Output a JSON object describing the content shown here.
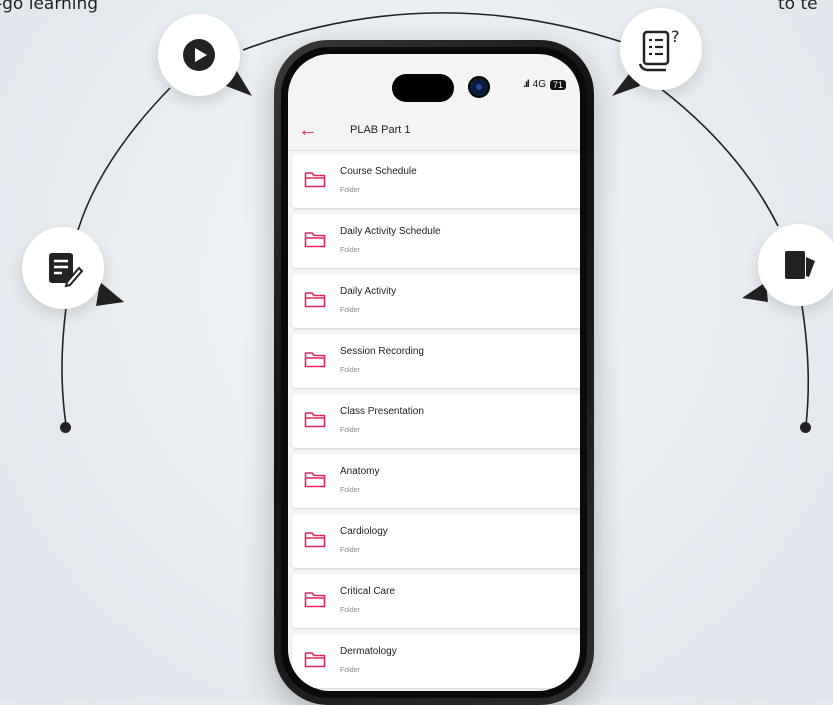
{
  "background_text": {
    "left": "-go learning",
    "right": "to te"
  },
  "icons": {
    "top_left": "play-icon",
    "top_right": "quiz-scroll-icon",
    "left": "notes-edit-icon",
    "right": "flashcards-icon"
  },
  "phone": {
    "status": {
      "signal": ".ıl",
      "network": "4G",
      "battery": "71"
    },
    "header": {
      "back_icon": "back-arrow-icon",
      "title": "PLAB Part 1"
    },
    "folders": [
      {
        "name": "Course Schedule",
        "type": "Folder"
      },
      {
        "name": "Daily Activity Schedule",
        "type": "Folder"
      },
      {
        "name": "Daily Activity",
        "type": "Folder"
      },
      {
        "name": "Session Recording",
        "type": "Folder"
      },
      {
        "name": "Class Presentation",
        "type": "Folder"
      },
      {
        "name": "Anatomy",
        "type": "Folder"
      },
      {
        "name": "Cardiology",
        "type": "Folder"
      },
      {
        "name": "Critical Care",
        "type": "Folder"
      },
      {
        "name": "Dermatology",
        "type": "Folder"
      }
    ]
  },
  "colors": {
    "accent": "#e0295a",
    "dark": "#222222"
  }
}
